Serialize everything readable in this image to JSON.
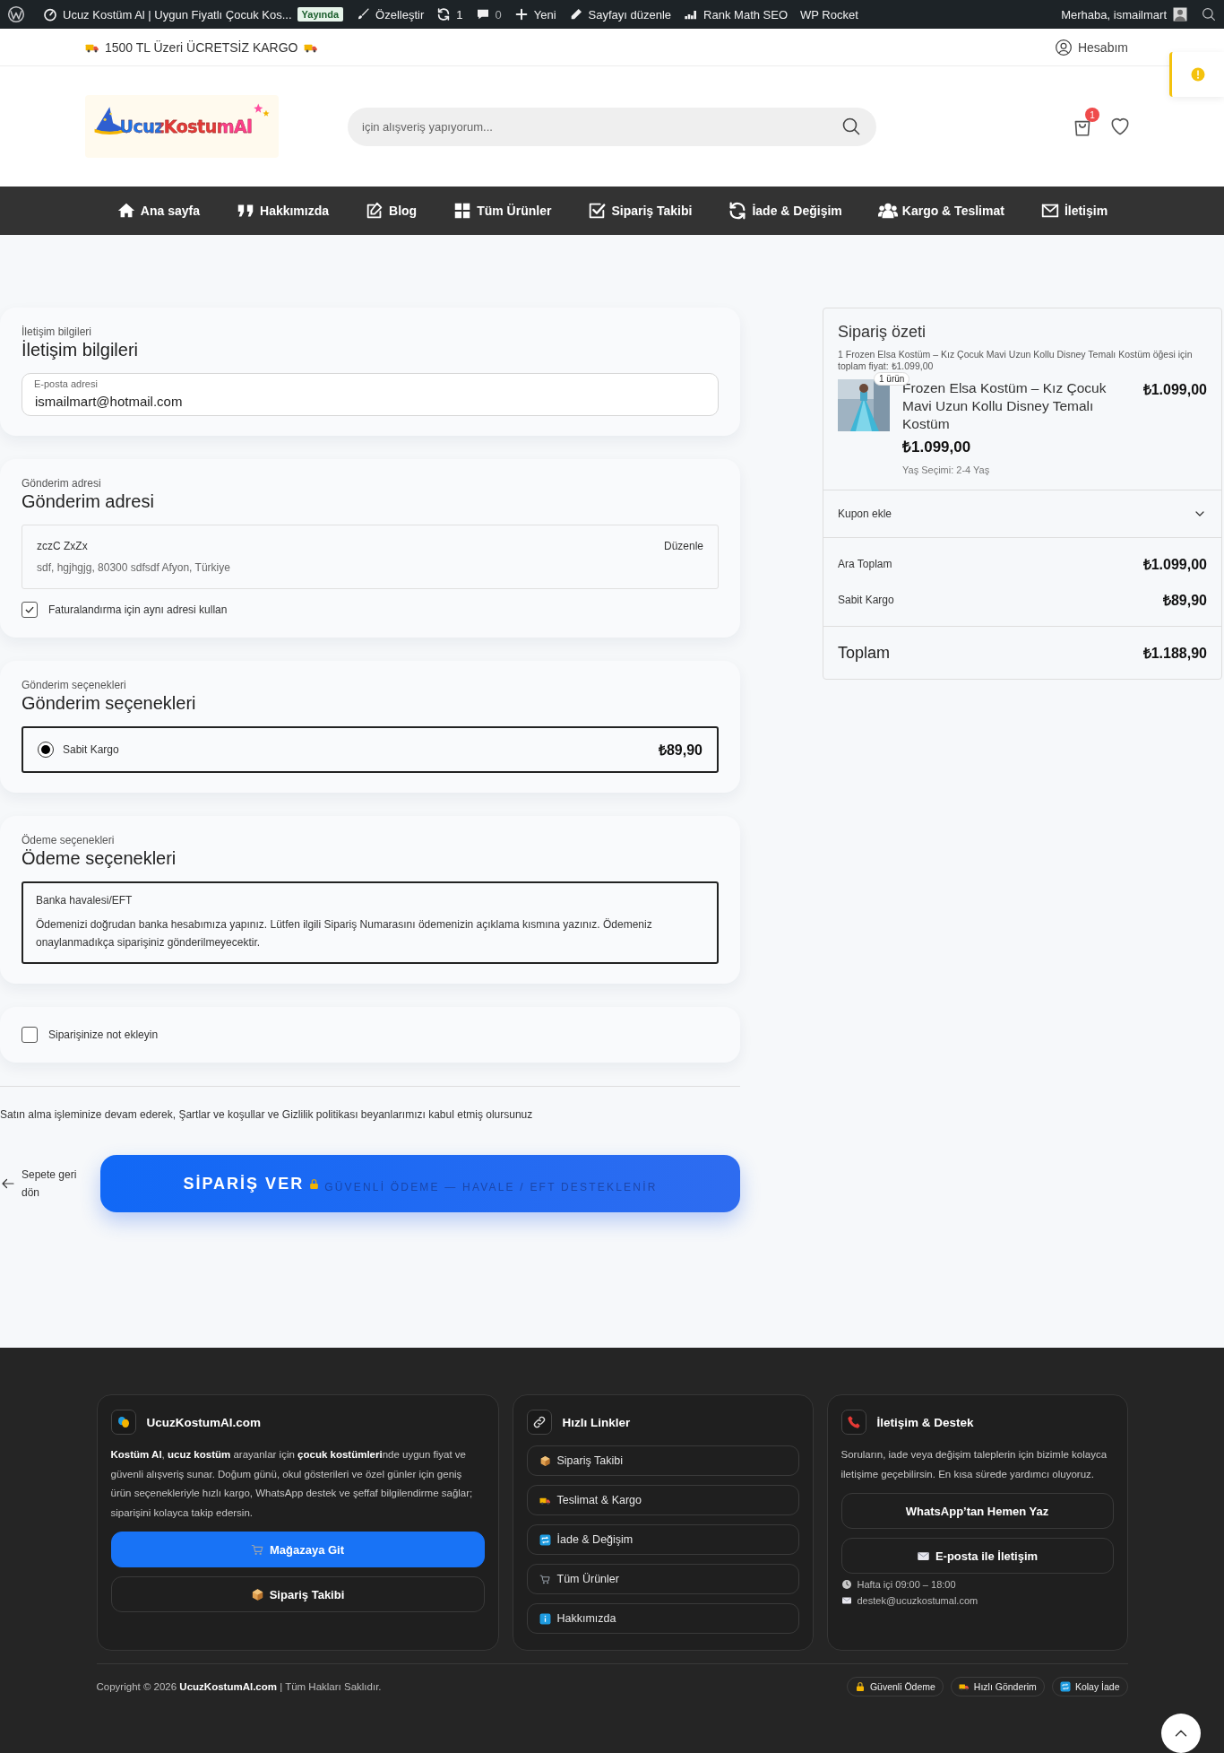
{
  "admin_bar": {
    "site_title": "Ucuz Kostüm Al | Uygun Fiyatlı Çocuk Kos...",
    "status": "Yayında",
    "items": [
      {
        "kind": "customize",
        "label": "Özelleştir"
      },
      {
        "kind": "updates",
        "label": "1"
      },
      {
        "kind": "comments",
        "label": "0"
      },
      {
        "kind": "new",
        "label": "Yeni"
      },
      {
        "kind": "edit",
        "label": "Sayfayı düzenle"
      },
      {
        "kind": "seo",
        "label": "Rank Math SEO"
      },
      {
        "kind": "plain",
        "label": "WP Rocket"
      }
    ],
    "greeting": "Merhaba, ismailmart"
  },
  "top_strip": {
    "notice": "1500 TL Üzeri ÜCRETSİZ KARGO",
    "account": "Hesabım"
  },
  "header": {
    "logo": "UcuzKostumAl",
    "search": {
      "placeholder": "için alışveriş yapıyorum..."
    },
    "cart_count": "1"
  },
  "nav": [
    {
      "kind": "home",
      "label": "Ana sayfa"
    },
    {
      "kind": "quote",
      "label": "Hakkımızda"
    },
    {
      "kind": "edit",
      "label": "Blog"
    },
    {
      "kind": "grid",
      "label": "Tüm Ürünler"
    },
    {
      "kind": "check",
      "label": "Sipariş Takibi"
    },
    {
      "kind": "refresh",
      "label": "İade & Değişim"
    },
    {
      "kind": "users",
      "label": "Kargo & Teslimat"
    },
    {
      "kind": "envelope",
      "label": "İletişim"
    }
  ],
  "checkout": {
    "contact": {
      "label": "İletişim bilgileri",
      "title": "İletişim bilgileri",
      "email": {
        "label": "E-posta adresi",
        "value": "ismailmart@hotmail.com"
      }
    },
    "shipping_address": {
      "label": "Gönderim adresi",
      "title": "Gönderim adresi",
      "name": "zczC ZxZx",
      "address": "sdf, hgjhgjg, 80300 sdfsdf Afyon, Türkiye",
      "edit": "Düzenle",
      "same_billing": {
        "label": "Faturalandırma için aynı adresi kullan",
        "checked": true
      }
    },
    "shipping_options": {
      "label": "Gönderim seçenekleri",
      "title": "Gönderim seçenekleri",
      "options": [
        {
          "label": "Sabit Kargo",
          "price": "₺89,90",
          "selected": true
        }
      ]
    },
    "payment": {
      "label": "Ödeme seçenekleri",
      "title": "Ödeme seçenekleri",
      "method": "Banka havalesi/EFT",
      "description": "Ödemenizi doğrudan banka hesabımıza yapınız. Lütfen ilgili Sipariş Numarasını ödemenizin açıklama kısmına yazınız. Ödemeniz onaylanmadıkça siparişiniz gönderilmeyecektir."
    },
    "note": {
      "label": "Siparişinize not ekleyin",
      "checked": false
    },
    "terms": "Satın alma işleminize devam ederek, Şartlar ve koşullar ve Gizlilik politikası beyanlarımızı kabul etmiş olursunuz",
    "back": "Sepete geri dön",
    "place_order": {
      "label": "SİPARİŞ VER",
      "subtitle": "GÜVENLİ ÖDEME — HAVALE / EFT DESTEKLENİR"
    }
  },
  "summary": {
    "title": "Sipariş özeti",
    "item": {
      "sr_text": "1 Frozen Elsa Kostüm – Kız Çocuk Mavi Uzun Kollu Disney Temalı Kostüm öğesi için toplam fiyat: ₺1.099,00",
      "quantity": "1 ürün",
      "name": "Frozen Elsa Kostüm – Kız Çocuk Mavi Uzun Kollu Disney Temalı Kostüm",
      "line_total": "₺1.099,00",
      "price": "₺1.099,00",
      "meta": "Yaş Seçimi: 2-4 Yaş"
    },
    "coupon": {
      "label": "Kupon ekle",
      "expanded": false
    },
    "rows": [
      {
        "label": "Ara Toplam",
        "value": "₺1.099,00"
      },
      {
        "label": "Sabit Kargo",
        "value": "₺89,90"
      }
    ],
    "total": {
      "label": "Toplam",
      "value": "₺1.188,90"
    }
  },
  "footer": {
    "brand": {
      "title": "UcuzKostumAl.com",
      "text": "**Kostüm Al**, **ucuz kostüm** arayanlar için **çocuk kostümleri**nde uygun fiyat ve güvenli alışveriş sunar. Doğum günü, okul gösterileri ve özel günler için geniş ürün seçenekleriyle hızlı kargo, WhatsApp destek ve şeffaf bilgilendirme sağlar; siparişini kolayca takip edersin.",
      "buttons": [
        {
          "kind": "cart",
          "label": "Mağazaya Git",
          "primary": true
        },
        {
          "kind": "box",
          "label": "Sipariş Takibi",
          "primary": false
        }
      ]
    },
    "links": {
      "title": "Hızlı Linkler",
      "items": [
        {
          "kind": "box",
          "label": "Sipariş Takibi"
        },
        {
          "kind": "truck",
          "label": "Teslimat & Kargo"
        },
        {
          "kind": "repeat",
          "label": "İade & Değişim"
        },
        {
          "kind": "cart",
          "label": "Tüm Ürünler"
        },
        {
          "kind": "info",
          "label": "Hakkımızda"
        }
      ]
    },
    "contact": {
      "title": "İletişim & Destek",
      "text": "Soruların, iade veya değişim taleplerin için bizimle kolayca iletişime geçebilirsin. En kısa sürede yardımcı oluyoruz.",
      "buttons": [
        {
          "kind": "plain",
          "label": "WhatsApp’tan Hemen Yaz"
        },
        {
          "kind": "mail",
          "label": "E-posta ile İletişim"
        }
      ],
      "hours": "Hafta içi 09:00 – 18:00",
      "email": "destek@ucuzkostumal.com"
    },
    "copyright": "Copyright © 2026 **UcuzKostumAl.com** | Tüm Hakları Saklıdır.",
    "badges": [
      {
        "kind": "lock",
        "label": "Güvenli Ödeme"
      },
      {
        "kind": "truck",
        "label": "Hızlı Gönderim"
      },
      {
        "kind": "repeat",
        "label": "Kolay İade"
      }
    ]
  }
}
